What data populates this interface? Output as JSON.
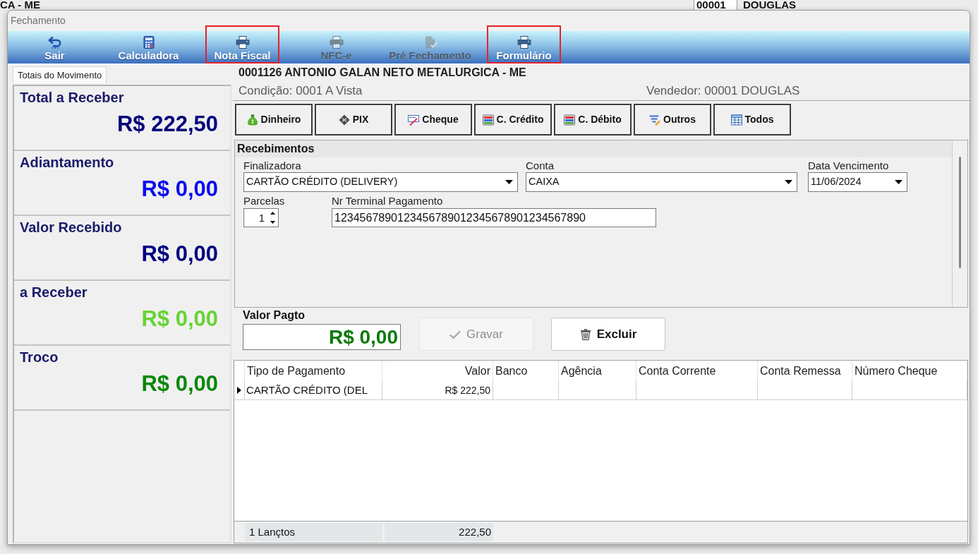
{
  "background_app": {
    "title_fragment": "CA - ME",
    "code": "00001",
    "name": "DOUGLAS"
  },
  "window": {
    "title": "Fechamento"
  },
  "toolbar": [
    {
      "label": "Sair",
      "disabled": false,
      "highlighted": false
    },
    {
      "label": "Calculadora",
      "disabled": false,
      "highlighted": false
    },
    {
      "label": "Nota Fiscal",
      "disabled": false,
      "highlighted": true
    },
    {
      "label": "NFC-e",
      "disabled": true,
      "highlighted": false
    },
    {
      "label": "Pré Fechamento",
      "disabled": true,
      "highlighted": false
    },
    {
      "label": "Formulário",
      "disabled": false,
      "highlighted": true
    }
  ],
  "tabs": [
    {
      "label": "Totais do Movimento",
      "selected": true
    }
  ],
  "totals": [
    {
      "label": "Total a Receber",
      "value": "R$ 222,50",
      "color": "#00007b"
    },
    {
      "label": "Adiantamento",
      "value": "R$ 0,00",
      "color": "#0a0af0"
    },
    {
      "label": "Valor Recebido",
      "value": "R$ 0,00",
      "color": "#000080"
    },
    {
      "label": "a Receber",
      "value": "R$ 0,00",
      "color": "#66d433"
    },
    {
      "label": "Troco",
      "value": "R$ 0,00",
      "color": "#088808"
    }
  ],
  "header": {
    "customer": "0001126 ANTONIO GALAN NETO METALURGICA - ME",
    "condition": "Condição: 0001 A Vista",
    "seller": "Vendedor: 00001 DOUGLAS"
  },
  "payment_methods": [
    {
      "label": "Dinheiro"
    },
    {
      "label": "PIX"
    },
    {
      "label": "Cheque"
    },
    {
      "label": "C. Crédito"
    },
    {
      "label": "C. Débito"
    },
    {
      "label": "Outros"
    },
    {
      "label": "Todos"
    }
  ],
  "receipts": {
    "title": "Recebimentos",
    "finalizer": {
      "label": "Finalizadora",
      "value": "CARTÃO CRÉDITO (DELIVERY)"
    },
    "account": {
      "label": "Conta",
      "value": "CAIXA"
    },
    "due_date": {
      "label": "Data Vencimento",
      "value": "11/06/2024"
    },
    "installments": {
      "label": "Parcelas",
      "value": "1"
    },
    "terminal": {
      "label": "Nr Terminal Pagamento",
      "value": "1234567890123456789012345678901234567890"
    }
  },
  "payment_value": {
    "label": "Valor Pagto",
    "value": "R$ 0,00"
  },
  "actions": [
    {
      "label": "Gravar",
      "disabled": true
    },
    {
      "label": "Excluir",
      "disabled": false
    }
  ],
  "grid": {
    "columns": [
      "Tipo de Pagamento",
      "Valor",
      "Banco",
      "Agência",
      "Conta Corrente",
      "Conta Remessa",
      "Número Cheque"
    ],
    "rows": [
      {
        "selected": true,
        "cells": [
          "CARTÃO CRÉDITO (DEL",
          "R$ 222,50"
        ]
      }
    ],
    "footer": {
      "count": "1 Lançtos",
      "total": "222,50"
    }
  }
}
